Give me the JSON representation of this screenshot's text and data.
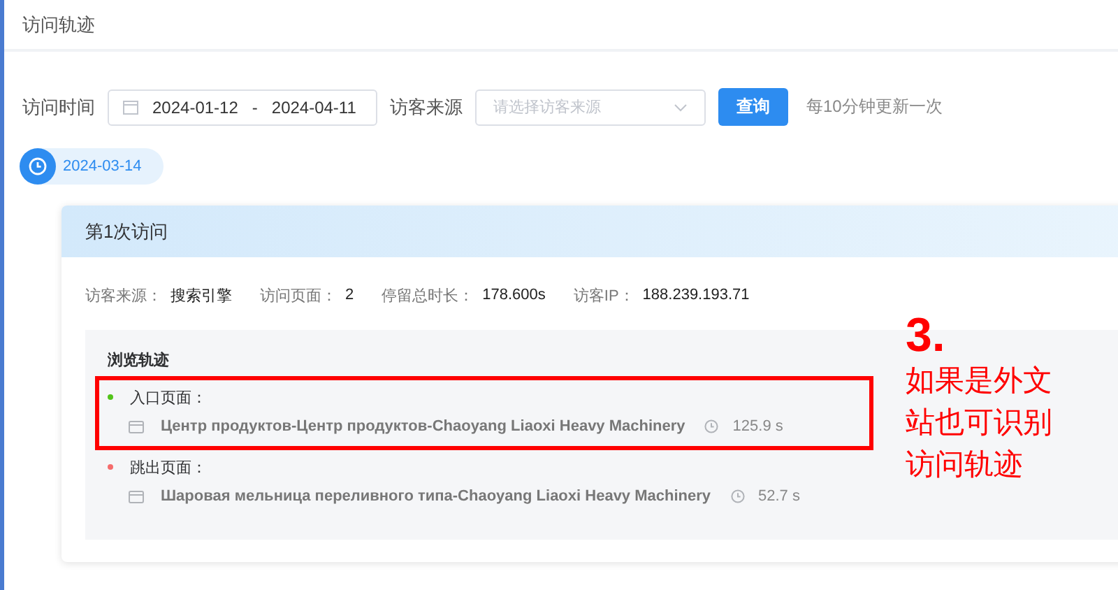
{
  "page_title": "访问轨迹",
  "filters": {
    "time_label": "访问时间",
    "date_start": "2024-01-12",
    "date_separator": "-",
    "date_end": "2024-04-11",
    "source_label": "访客来源",
    "source_placeholder": "请选择访客来源",
    "query_button": "查询",
    "hint": "每10分钟更新一次"
  },
  "date_tag": "2024-03-14",
  "visit": {
    "title": "第1次访问",
    "stats": [
      {
        "label": "访客来源：",
        "value": "搜索引擎"
      },
      {
        "label": "访问页面：",
        "value": "2"
      },
      {
        "label": "停留总时长：",
        "value": "178.600s"
      },
      {
        "label": "访客IP：",
        "value": "188.239.193.71"
      }
    ],
    "trail_title": "浏览轨迹",
    "steps": [
      {
        "label": "入口页面：",
        "color": "#52c41a",
        "page": "Центр продуктов-Центр продуктов-Chaoyang Liaoxi Heavy Machinery",
        "duration": "125.9 s"
      },
      {
        "label": "跳出页面：",
        "color": "#f56c6c",
        "page": "Шаровая мельница переливного типа-Chaoyang Liaoxi Heavy Machinery",
        "duration": "52.7 s"
      }
    ]
  },
  "annotation": {
    "number": "3.",
    "lines": [
      "如果是外文",
      "站也可识别",
      "访问轨迹"
    ]
  }
}
